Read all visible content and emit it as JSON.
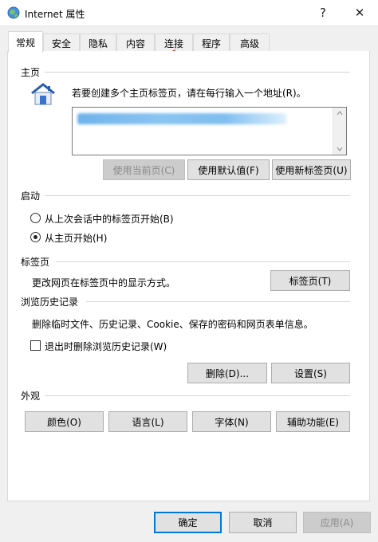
{
  "window": {
    "title": "Internet 属性",
    "help": "?",
    "close": "✕"
  },
  "tabs": [
    "常规",
    "安全",
    "隐私",
    "内容",
    "连接",
    "程序",
    "高级"
  ],
  "home": {
    "title": "主页",
    "description": "若要创建多个主页标签页，请在每行输入一个地址(R)。",
    "buttons": {
      "current": "使用当前页(C)",
      "default": "使用默认值(F)",
      "newtab": "使用新标签页(U)"
    }
  },
  "startup": {
    "title": "启动",
    "options": [
      "从上次会话中的标签页开始(B)",
      "从主页开始(H)"
    ],
    "selected": 1
  },
  "tabsgroup": {
    "title": "标签页",
    "description": "更改网页在标签页中的显示方式。",
    "button": "标签页(T)"
  },
  "history": {
    "title": "浏览历史记录",
    "description": "删除临时文件、历史记录、Cookie、保存的密码和网页表单信息。",
    "checkbox": "退出时删除浏览历史记录(W)",
    "delete": "删除(D)...",
    "settings": "设置(S)"
  },
  "appearance": {
    "title": "外观",
    "buttons": [
      "颜色(O)",
      "语言(L)",
      "字体(N)",
      "辅助功能(E)"
    ]
  },
  "footer": {
    "ok": "确定",
    "cancel": "取消",
    "apply": "应用(A)"
  },
  "colors": {
    "annotation_arrow": "#e0201a",
    "focus": "#0078d7"
  }
}
